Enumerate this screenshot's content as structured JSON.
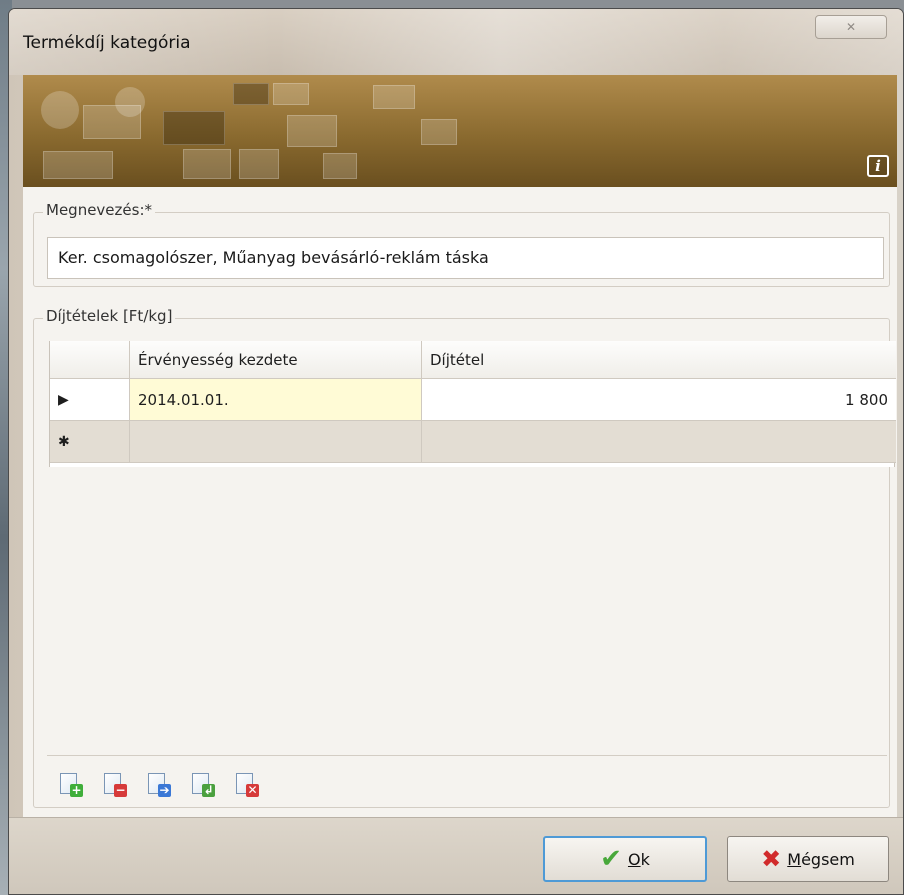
{
  "window": {
    "title": "Termékdíj kategória",
    "close_glyph": "✕"
  },
  "banner": {
    "info_icon": "i"
  },
  "name_group": {
    "label": "Megnevezés:*",
    "value": "Ker. csomagolószer, Műanyag bevásárló-reklám táska"
  },
  "rates_group": {
    "label": "Díjtételek [Ft/kg]",
    "columns": [
      "",
      "Érvényesség kezdete",
      "Díjtétel"
    ],
    "rows": [
      {
        "indicator": "▶",
        "start": "2014.01.01.",
        "fee": "1 800"
      }
    ],
    "new_row_indicator": "✱",
    "toolbar_icons": [
      "add-row-icon",
      "delete-row-icon",
      "import-icon",
      "edit-row-icon",
      "clear-rows-icon"
    ]
  },
  "footer": {
    "ok": {
      "accel": "O",
      "rest": "k"
    },
    "cancel": {
      "accel": "M",
      "rest": "égsem"
    }
  },
  "colors": {
    "banner": "#8a6a2f",
    "selected_cell": "#fffbd6",
    "ok_focus_border": "#4e9ad6"
  }
}
